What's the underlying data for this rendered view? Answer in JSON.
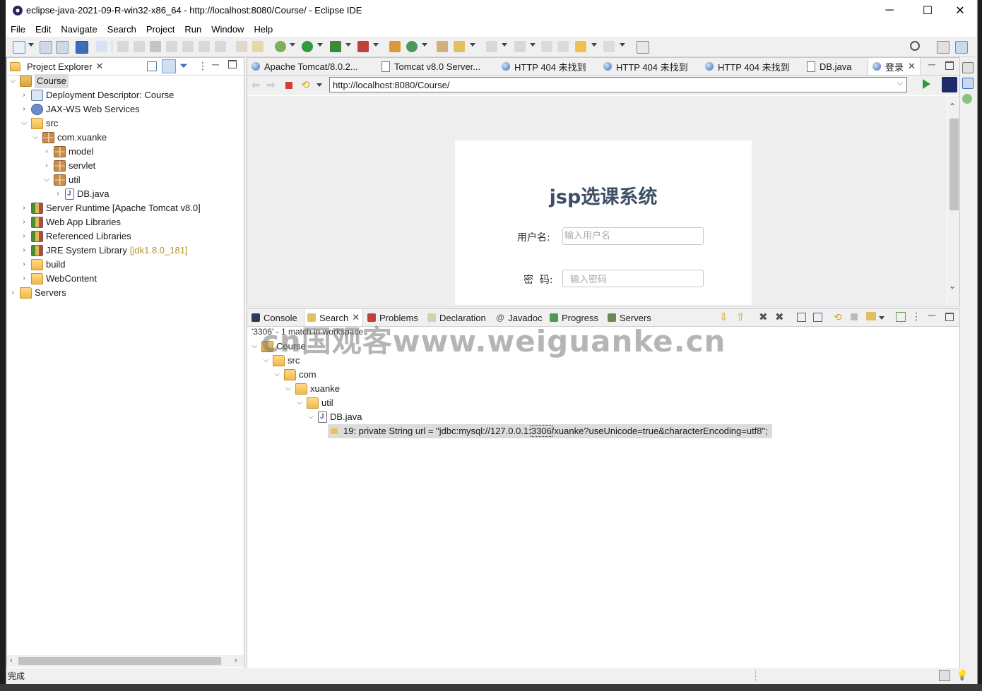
{
  "window": {
    "title": "eclipse-java-2021-09-R-win32-x86_64 - http://localhost:8080/Course/ - Eclipse IDE",
    "min": "─",
    "max": "☐",
    "close": "✕"
  },
  "menu": [
    "File",
    "Edit",
    "Navigate",
    "Search",
    "Project",
    "Run",
    "Window",
    "Help"
  ],
  "project_explorer": {
    "title": "Project Explorer",
    "tree": [
      {
        "label": "Course",
        "level": 0,
        "expanded": true,
        "icon": "project-icon",
        "selected": true
      },
      {
        "label": "Deployment Descriptor: Course",
        "level": 1,
        "expanded": false,
        "icon": "deployment-descriptor-icon"
      },
      {
        "label": "JAX-WS Web Services",
        "level": 1,
        "expanded": false,
        "icon": "web-services-icon"
      },
      {
        "label": "src",
        "level": 1,
        "expanded": true,
        "icon": "source-folder-icon"
      },
      {
        "label": "com.xuanke",
        "level": 2,
        "expanded": true,
        "icon": "package-icon"
      },
      {
        "label": "model",
        "level": 3,
        "expanded": false,
        "icon": "package-icon"
      },
      {
        "label": "servlet",
        "level": 3,
        "expanded": false,
        "icon": "package-icon"
      },
      {
        "label": "util",
        "level": 3,
        "expanded": true,
        "icon": "package-icon"
      },
      {
        "label": "DB.java",
        "level": 4,
        "expanded": false,
        "icon": "java-file-icon"
      },
      {
        "label": "Server Runtime [Apache Tomcat v8.0]",
        "level": 1,
        "expanded": false,
        "icon": "library-icon"
      },
      {
        "label": "Web App Libraries",
        "level": 1,
        "expanded": false,
        "icon": "library-icon"
      },
      {
        "label": "Referenced Libraries",
        "level": 1,
        "expanded": false,
        "icon": "library-icon"
      },
      {
        "label": "JRE System Library",
        "suffix": "[jdk1.8.0_181]",
        "level": 1,
        "expanded": false,
        "icon": "library-icon"
      },
      {
        "label": "build",
        "level": 1,
        "expanded": false,
        "icon": "folder-icon"
      },
      {
        "label": "WebContent",
        "level": 1,
        "expanded": false,
        "icon": "folder-icon"
      },
      {
        "label": "Servers",
        "level": 0,
        "expanded": false,
        "icon": "servers-folder-icon"
      }
    ]
  },
  "editor": {
    "tabs": [
      {
        "label": "Apache Tomcat/8.0.2...",
        "icon": "globe-icon"
      },
      {
        "label": "Tomcat v8.0 Server...",
        "icon": "server-config-icon"
      },
      {
        "label": "HTTP 404 未找到",
        "icon": "globe-icon"
      },
      {
        "label": "HTTP 404 未找到",
        "icon": "globe-icon"
      },
      {
        "label": "HTTP 404 未找到",
        "icon": "globe-icon"
      },
      {
        "label": "DB.java",
        "icon": "java-file-icon"
      },
      {
        "label": "登录",
        "icon": "globe-icon",
        "active": true
      }
    ],
    "url": "http://localhost:8080/Course/"
  },
  "login_page": {
    "title": "jsp选课系统",
    "username_label": "用户名:",
    "username_placeholder": "输入用户名",
    "password_label": "密  码:",
    "password_placeholder": "输入密码"
  },
  "bottom_panel": {
    "tabs": [
      "Console",
      "Search",
      "Problems",
      "Declaration",
      "Javadoc",
      "Progress",
      "Servers"
    ],
    "search_summary": "'3306' - 1 match in workspace",
    "results": [
      {
        "label": "Course",
        "level": 0,
        "icon": "project-icon"
      },
      {
        "label": "src",
        "level": 1,
        "icon": "folder-icon"
      },
      {
        "label": "com",
        "level": 2,
        "icon": "folder-icon"
      },
      {
        "label": "xuanke",
        "level": 3,
        "icon": "folder-icon"
      },
      {
        "label": "util",
        "level": 4,
        "icon": "folder-icon"
      },
      {
        "label": "DB.java",
        "level": 5,
        "icon": "java-file-icon"
      }
    ],
    "match_prefix": "19: private String url = \"jdbc:mysql://127.0.0.1:",
    "match_term": "3306",
    "match_suffix": "/xuanke?useUnicode=true&characterEncoding=utf8\";"
  },
  "watermark": "cn国观客www.weiguanke.cn",
  "status": "完成",
  "colors": {
    "accent": "#3a70b8",
    "selection": "#dcdcdc",
    "login_title": "#3d4f65",
    "library_suffix": "#b8902a"
  }
}
